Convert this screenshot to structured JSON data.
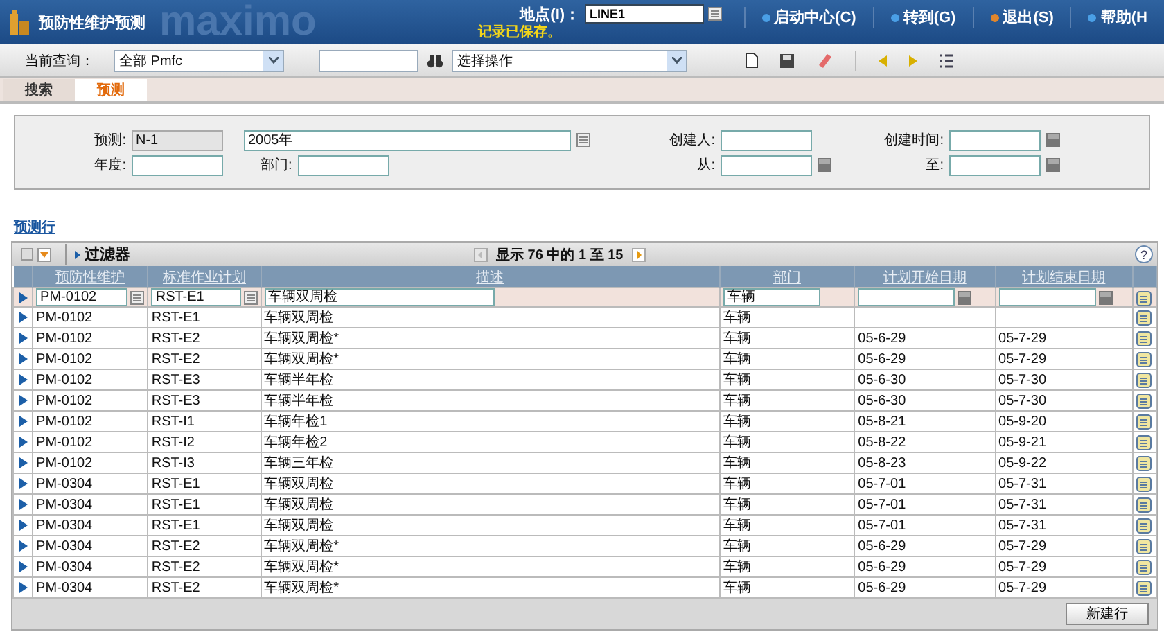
{
  "header": {
    "title": "预防性维护预测",
    "logo_text": "maximo",
    "site_label": "地点(I)：",
    "site_value": "LINE1",
    "status": "记录已保存。",
    "links": [
      {
        "label": "启动中心(C)",
        "color": "#4a9fe6"
      },
      {
        "label": "转到(G)",
        "color": "#4a9fe6"
      },
      {
        "label": "退出(S)",
        "color": "#e0862c"
      },
      {
        "label": "帮助(H",
        "color": "#4a9fe6"
      }
    ]
  },
  "toolbar": {
    "query_label": "当前查询：",
    "query_value": "全部 Pmfc",
    "action_value": "选择操作"
  },
  "tabs": [
    {
      "label": "搜索",
      "selected": false
    },
    {
      "label": "预测",
      "selected": true
    }
  ],
  "form": {
    "rows": [
      {
        "fields": [
          {
            "label": "预测:",
            "value": "N-1",
            "kind": "readonly"
          },
          {
            "value": "2005年",
            "kind": "lookup"
          },
          {
            "label": "创建人:",
            "kind": "text"
          },
          {
            "label": "创建时间:",
            "kind": "date"
          }
        ]
      },
      {
        "fields": [
          {
            "label": "年度:",
            "kind": "text"
          },
          {
            "label": "部门:",
            "kind": "text"
          },
          {
            "label": "从:",
            "kind": "date"
          },
          {
            "label": "至:",
            "kind": "date"
          }
        ]
      }
    ]
  },
  "section_title": "预测行",
  "table": {
    "filter_label": "过滤器",
    "range_text": "显示 76 中的 1 至 15",
    "help": "?",
    "columns": [
      "预防性维护",
      "标准作业计划",
      "描述",
      "部门",
      "计划开始日期",
      "计划结束日期"
    ],
    "rows": [
      {
        "pm": "PM-0102",
        "plan": "RST-E1",
        "desc": "车辆双周检",
        "dept": "车辆",
        "selected": true
      },
      {
        "pm": "PM-0102",
        "plan": "RST-E1",
        "desc": "车辆双周检",
        "dept": "车辆",
        "selected": false
      },
      {
        "pm": "PM-0102",
        "plan": "RST-E2",
        "desc": "车辆双周检*",
        "dept": "车辆",
        "start": "05-6-29",
        "end": "05-7-29",
        "selected": false
      },
      {
        "pm": "PM-0102",
        "plan": "RST-E2",
        "desc": "车辆双周检*",
        "dept": "车辆",
        "start": "05-6-29",
        "end": "05-7-29",
        "selected": false
      },
      {
        "pm": "PM-0102",
        "plan": "RST-E3",
        "desc": "车辆半年检",
        "dept": "车辆",
        "start": "05-6-30",
        "end": "05-7-30",
        "selected": false
      },
      {
        "pm": "PM-0102",
        "plan": "RST-E3",
        "desc": "车辆半年检",
        "dept": "车辆",
        "start": "05-6-30",
        "end": "05-7-30",
        "selected": false
      },
      {
        "pm": "PM-0102",
        "plan": "RST-I1",
        "desc": "车辆年检1",
        "dept": "车辆",
        "start": "05-8-21",
        "end": "05-9-20",
        "selected": false
      },
      {
        "pm": "PM-0102",
        "plan": "RST-I2",
        "desc": "车辆年检2",
        "dept": "车辆",
        "start": "05-8-22",
        "end": "05-9-21",
        "selected": false
      },
      {
        "pm": "PM-0102",
        "plan": "RST-I3",
        "desc": "车辆三年检",
        "dept": "车辆",
        "start": "05-8-23",
        "end": "05-9-22",
        "selected": false
      },
      {
        "pm": "PM-0304",
        "plan": "RST-E1",
        "desc": "车辆双周检",
        "dept": "车辆",
        "start": "05-7-01",
        "end": "05-7-31",
        "selected": false
      },
      {
        "pm": "PM-0304",
        "plan": "RST-E1",
        "desc": "车辆双周检",
        "dept": "车辆",
        "start": "05-7-01",
        "end": "05-7-31",
        "selected": false
      },
      {
        "pm": "PM-0304",
        "plan": "RST-E1",
        "desc": "车辆双周检",
        "dept": "车辆",
        "start": "05-7-01",
        "end": "05-7-31",
        "selected": false
      },
      {
        "pm": "PM-0304",
        "plan": "RST-E2",
        "desc": "车辆双周检*",
        "dept": "车辆",
        "start": "05-6-29",
        "end": "05-7-29",
        "selected": false
      },
      {
        "pm": "PM-0304",
        "plan": "RST-E2",
        "desc": "车辆双周检*",
        "dept": "车辆",
        "start": "05-6-29",
        "end": "05-7-29",
        "selected": false
      },
      {
        "pm": "PM-0304",
        "plan": "RST-E2",
        "desc": "车辆双周检*",
        "dept": "车辆",
        "start": "05-6-29",
        "end": "05-7-29",
        "selected": false
      }
    ],
    "new_row_button": "新建行"
  }
}
